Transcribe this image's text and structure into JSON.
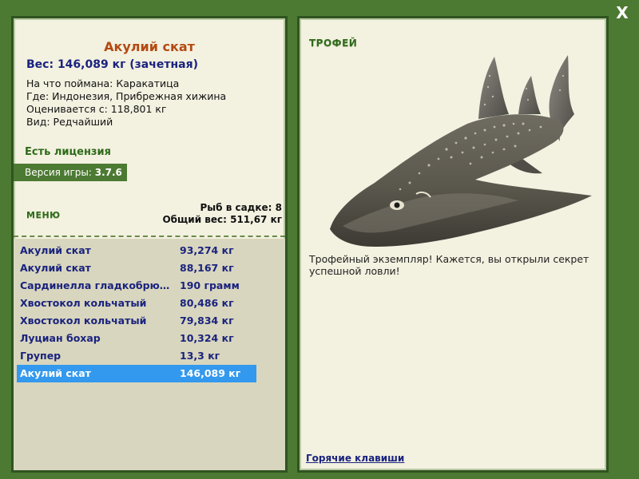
{
  "window": {
    "close_label": "X"
  },
  "fish_info": {
    "name": "Акулий скат",
    "weight_line": "Вес: 146,089 кг (зачетная)",
    "caught_on": "На что поймана: Каракатица",
    "location": "Где: Индонезия, Прибрежная хижина",
    "valued_from": "Оценивается с: 118,801 кг",
    "kind": "Вид: Редчайший"
  },
  "license": "Есть лицензия",
  "version": {
    "label": "Версия игры:",
    "value": "3.7.6"
  },
  "menu_label": "МЕНЮ",
  "stats": {
    "fish_in_net": "Рыб в садке: 8",
    "total_weight": "Общий вес: 511,67 кг"
  },
  "fish_list": [
    {
      "name": "Акулий скат",
      "weight": "93,274 кг"
    },
    {
      "name": "Акулий скат",
      "weight": "88,167 кг"
    },
    {
      "name": "Сардинелла гладкобрю…",
      "weight": "190 грамм"
    },
    {
      "name": "Хвостокол кольчатый",
      "weight": "80,486 кг"
    },
    {
      "name": "Хвостокол кольчатый",
      "weight": "79,834 кг"
    },
    {
      "name": "Луциан бохар",
      "weight": "10,324 кг"
    },
    {
      "name": "Групер",
      "weight": "13,3 кг"
    },
    {
      "name": "Акулий скат",
      "weight": "146,089 кг"
    }
  ],
  "selected_index": 7,
  "trophy": {
    "label": "ТРОФЕЙ",
    "text": "Трофейный экземпляр! Кажется, вы открыли секрет успешной ловли!"
  },
  "hotkeys_link": "Горячие клавиши",
  "colors": {
    "frame_green": "#4d7a33",
    "panel_bg": "#f3f1e0",
    "selected_blue": "#3399ee",
    "list_text": "#1a237e",
    "title_orange": "#b34a12"
  },
  "icons": {
    "close": "close-icon",
    "fish": "shark-ray-image"
  }
}
